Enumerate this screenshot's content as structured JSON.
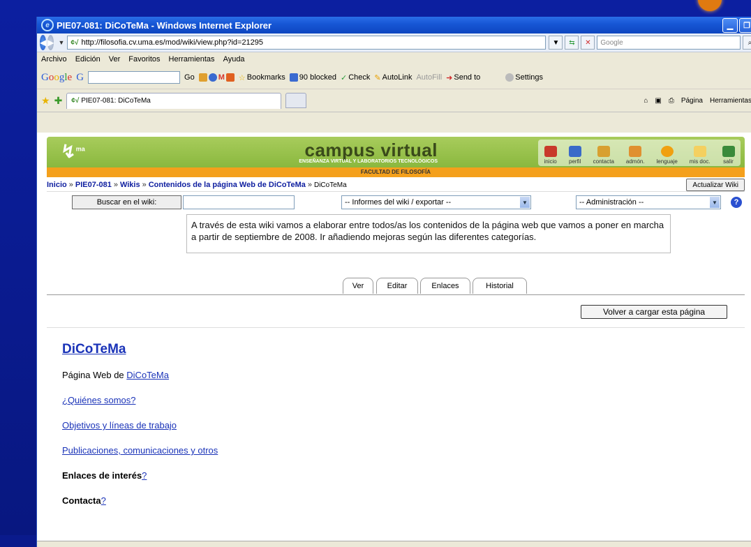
{
  "window": {
    "title": "PIE07-081: DiCoTeMa - Windows Internet Explorer",
    "min_label": "▁",
    "max_label": "❐"
  },
  "address": {
    "url": "http://filosofia.cv.uma.es/mod/wiki/view.php?id=21295",
    "search_placeholder": "Google"
  },
  "menu": [
    "Archivo",
    "Edición",
    "Ver",
    "Favoritos",
    "Herramientas",
    "Ayuda"
  ],
  "googlebar": {
    "go": "Go",
    "bookmarks": "Bookmarks",
    "blocked": "90 blocked",
    "check": "Check",
    "autolink": "AutoLink",
    "autofill": "AutoFill",
    "sendto": "Send to",
    "settings": "Settings"
  },
  "tab": {
    "title": "PIE07-081: DiCoTeMa",
    "pagina": "Página",
    "herramientas": "Herramientas"
  },
  "banner": {
    "logo": "ma",
    "title": "campus virtual",
    "subtitle": "ENSEÑANZA VIRTUAL Y LABORATORIOS TECNOLÓGICOS",
    "faculty": "FACULTAD DE FILOSOFÍA",
    "icons": [
      "inicio",
      "perfil",
      "contacta",
      "admón.",
      "lenguaje",
      "mis doc.",
      "salir"
    ],
    "icon_colors": [
      "#c83a2a",
      "#3a6ac8",
      "#d8a030",
      "#e09030",
      "#f0a010",
      "#f4d060",
      "#3a8a3a"
    ]
  },
  "breadcrumb": {
    "inicio": "Inicio",
    "course": "PIE07-081",
    "wikis": "Wikis",
    "section": "Contenidos de la página Web de DiCoTeMa",
    "current": "DiCoTeMa",
    "update_button": "Actualizar Wiki"
  },
  "wikibar": {
    "search_button": "Buscar en el wiki:",
    "reports_select": "-- Informes del wiki / exportar --",
    "admin_select": "-- Administración --",
    "help": "?"
  },
  "description": "A través de esta wiki vamos a elaborar entre todos/as los contenidos de la página web que vamos a poner en marcha a partir de septiembre de 2008. Ir añadiendo mejoras según las diferentes categorías.",
  "wiki_tabs": [
    "Ver",
    "Editar",
    "Enlaces",
    "Historial"
  ],
  "reload_button": "Volver a cargar esta página",
  "page": {
    "title": "DiCoTeMa",
    "intro_text": "Página Web de ",
    "intro_link": "DiCoTeMa",
    "links": [
      "¿Quiénes somos?",
      "Objetivos y líneas de trabajo",
      "Publicaciones, comunicaciones y otros"
    ],
    "enlaces": "Enlaces de interés",
    "contacta": "Contacta",
    "missing": "?"
  }
}
